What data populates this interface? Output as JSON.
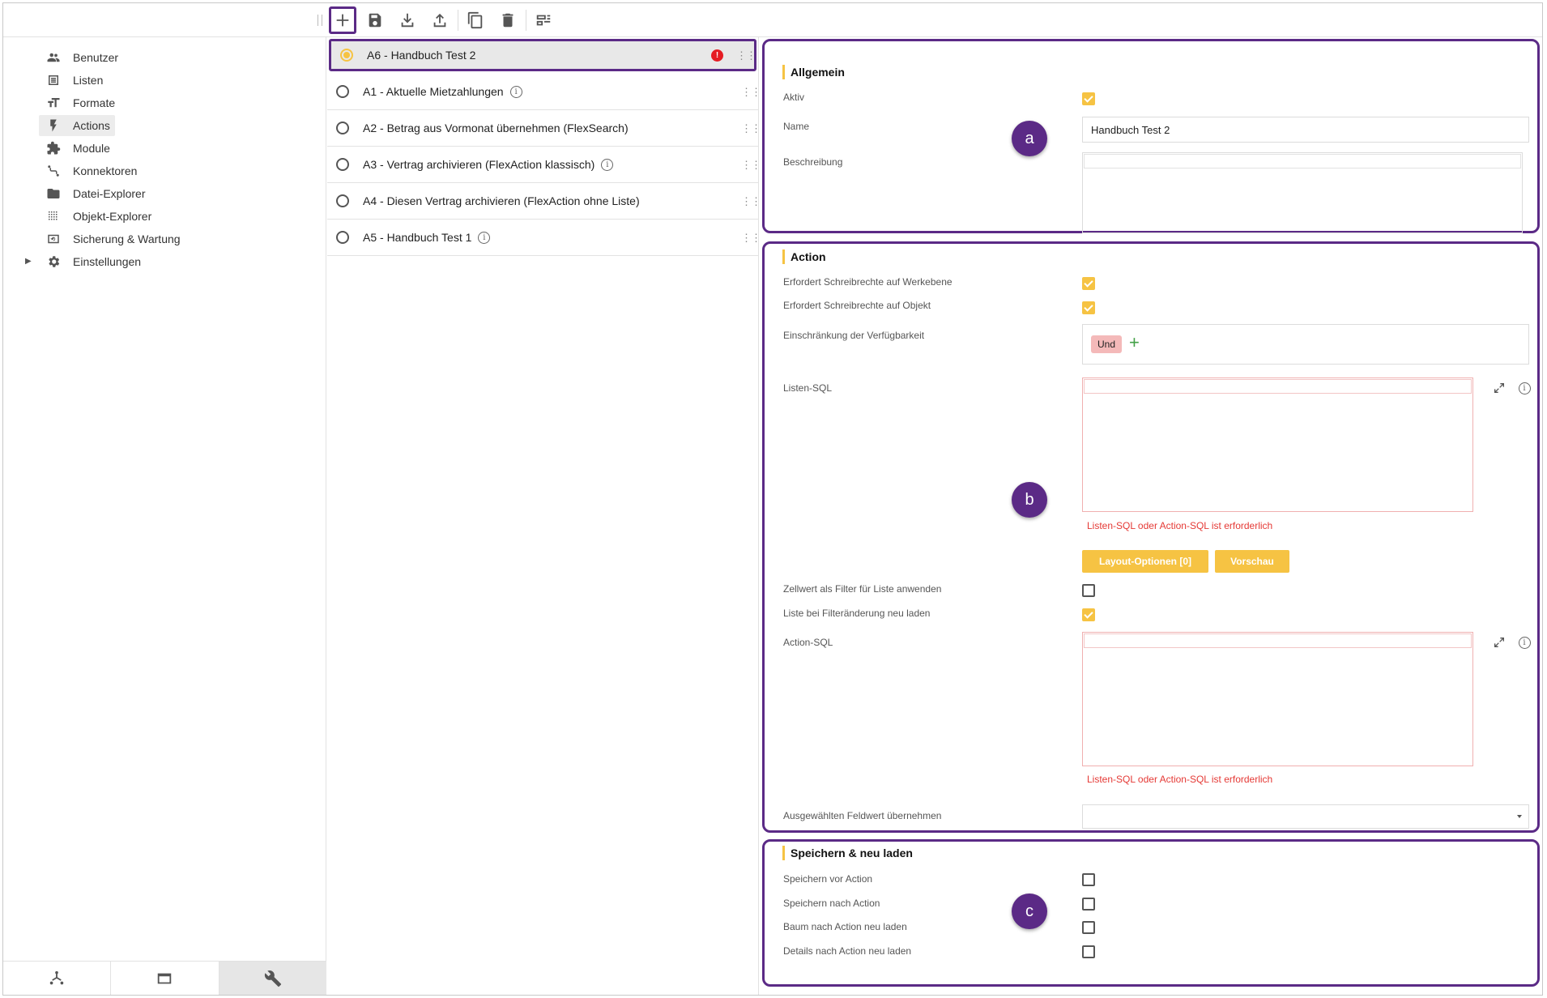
{
  "toolbar": {
    "buttons": [
      "add-icon",
      "save-icon",
      "download-icon",
      "upload-icon",
      "copy-icon",
      "delete-icon",
      "layout-icon"
    ]
  },
  "nav": {
    "items": [
      {
        "label": "Benutzer",
        "icon": "users-icon"
      },
      {
        "label": "Listen",
        "icon": "list-icon"
      },
      {
        "label": "Formate",
        "icon": "text-format-icon"
      },
      {
        "label": "Actions",
        "icon": "lightning-icon"
      },
      {
        "label": "Module",
        "icon": "puzzle-icon"
      },
      {
        "label": "Konnektoren",
        "icon": "connector-icon"
      },
      {
        "label": "Datei-Explorer",
        "icon": "folder-icon"
      },
      {
        "label": "Objekt-Explorer",
        "icon": "grid-dots-icon"
      },
      {
        "label": "Sicherung & Wartung",
        "icon": "backup-icon"
      },
      {
        "label": "Einstellungen",
        "icon": "gear-icon"
      }
    ],
    "active": "Actions",
    "bottom_tabs": [
      "tree-icon",
      "window-icon",
      "wrench-icon"
    ]
  },
  "actions_list": [
    {
      "label": "A6 - Handbuch Test 2",
      "selected": true,
      "error": true,
      "info": false
    },
    {
      "label": "A1 - Aktuelle Mietzahlungen",
      "selected": false,
      "error": false,
      "info": true
    },
    {
      "label": "A2 - Betrag aus Vormonat übernehmen (FlexSearch)",
      "selected": false,
      "error": false,
      "info": false
    },
    {
      "label": "A3 - Vertrag archivieren (FlexAction klassisch)",
      "selected": false,
      "error": false,
      "info": true
    },
    {
      "label": "A4 - Diesen Vertrag archivieren (FlexAction ohne Liste)",
      "selected": false,
      "error": false,
      "info": false
    },
    {
      "label": "A5 - Handbuch Test 1",
      "selected": false,
      "error": false,
      "info": true
    }
  ],
  "general": {
    "title": "Allgemein",
    "aktiv_label": "Aktiv",
    "aktiv_checked": true,
    "name_label": "Name",
    "name_value": "Handbuch Test 2",
    "beschreibung_label": "Beschreibung",
    "badge": "a"
  },
  "action": {
    "title": "Action",
    "schreib_werk_label": "Erfordert Schreibrechte auf Werkebene",
    "schreib_werk_checked": true,
    "schreib_obj_label": "Erfordert Schreibrechte auf Objekt",
    "schreib_obj_checked": true,
    "einschraenkung_label": "Einschränkung der Verfügbarkeit",
    "und_chip": "Und",
    "plus": "+",
    "listen_sql_label": "Listen-SQL",
    "listen_sql_error": "Listen-SQL oder Action-SQL ist erforderlich",
    "layout_btn": "Layout-Optionen [0]",
    "vorschau_btn": "Vorschau",
    "zellwert_label": "Zellwert als Filter für Liste anwenden",
    "zellwert_checked": false,
    "liste_neu_label": "Liste bei Filteränderung neu laden",
    "liste_neu_checked": true,
    "action_sql_label": "Action-SQL",
    "action_sql_error": "Listen-SQL oder Action-SQL ist erforderlich",
    "feldwert_label": "Ausgewählten Feldwert übernehmen",
    "badge": "b"
  },
  "save_reload": {
    "title": "Speichern & neu laden",
    "items": [
      {
        "label": "Speichern vor Action",
        "checked": false
      },
      {
        "label": "Speichern nach Action",
        "checked": false
      },
      {
        "label": "Baum nach Action neu laden",
        "checked": false
      },
      {
        "label": "Details nach Action neu laden",
        "checked": false
      }
    ],
    "badge": "c"
  },
  "colors": {
    "accent": "#f6c343",
    "highlight": "#5b2a86",
    "error": "#e53935"
  }
}
